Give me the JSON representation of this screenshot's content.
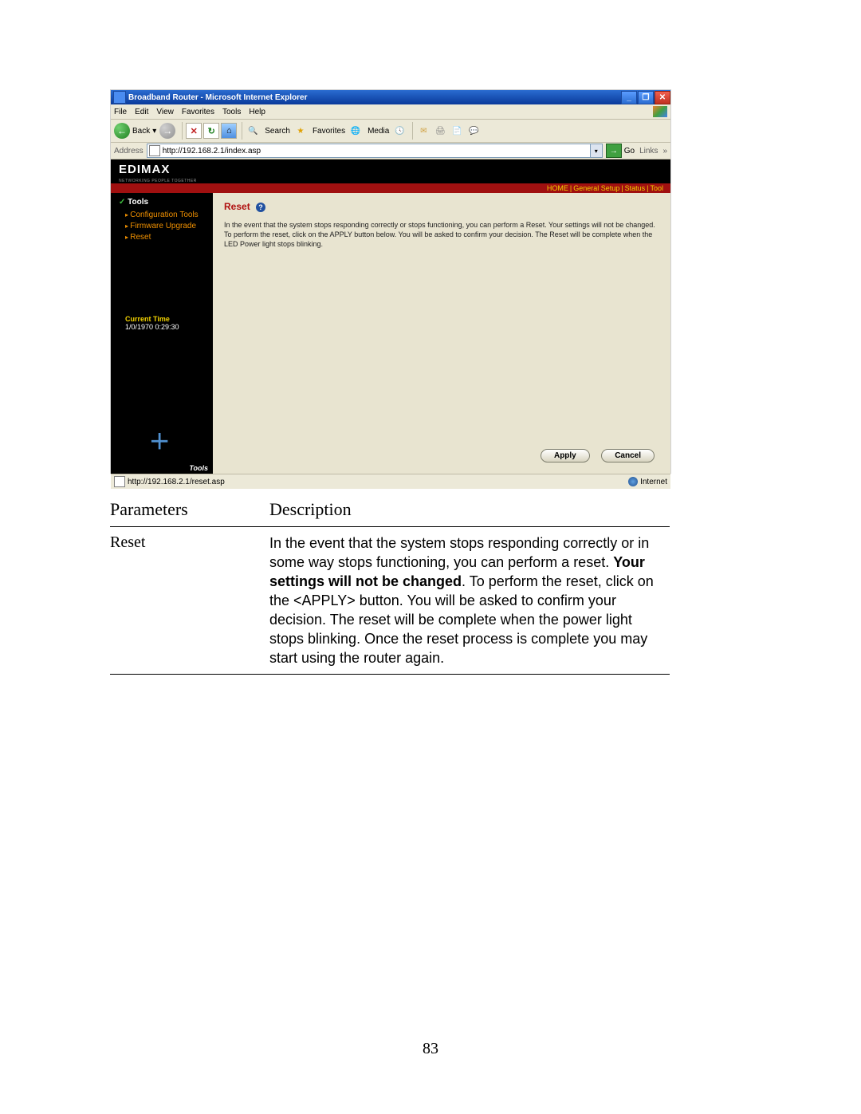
{
  "browser": {
    "title": "Broadband Router - Microsoft Internet Explorer",
    "menus": {
      "file": "File",
      "edit": "Edit",
      "view": "View",
      "favorites": "Favorites",
      "tools": "Tools",
      "help": "Help"
    },
    "toolbar": {
      "back": "Back",
      "search": "Search",
      "favorites": "Favorites",
      "media": "Media"
    },
    "address_label": "Address",
    "address_value": "http://192.168.2.1/index.asp",
    "go": "Go",
    "links": "Links",
    "status_url": "http://192.168.2.1/reset.asp",
    "status_zone": "Internet"
  },
  "router": {
    "logo": "EDIMAX",
    "logo_sub": "NETWORKING PEOPLE TOGETHER",
    "nav": {
      "home": "HOME",
      "general": "General Setup",
      "status": "Status",
      "tool": "Tool"
    },
    "sidebar": {
      "title": "Tools",
      "items": [
        "Configuration Tools",
        "Firmware Upgrade",
        "Reset"
      ],
      "current_time_label": "Current Time",
      "current_time_value": "1/0/1970 0:29:30",
      "bottom_label": "Tools"
    },
    "content": {
      "heading": "Reset",
      "body": "In the event that the system stops responding correctly or stops functioning, you can perform a Reset. Your settings will not be changed. To perform the reset, click on the APPLY button below. You will be asked to confirm your decision. The Reset will be complete when the LED Power light stops blinking.",
      "apply": "Apply",
      "cancel": "Cancel"
    }
  },
  "doc": {
    "header_param": "Parameters",
    "header_desc": "Description",
    "row_param": "Reset",
    "row_desc_1": "In the event that the system stops responding correctly or in some way stops functioning, you can perform a reset. ",
    "row_desc_bold": "Your settings will not be changed",
    "row_desc_2": ". To perform the reset, click on the <APPLY> button. You will be asked to confirm your decision. The reset will be complete when the power light stops blinking. Once the reset process is complete you may start using the router again.",
    "page_number": "83"
  }
}
